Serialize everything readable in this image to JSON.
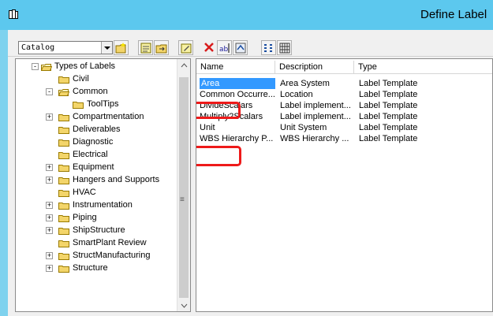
{
  "window": {
    "title": "Define Label"
  },
  "toolbar": {
    "combo_value": "Catalog",
    "buttons": [
      "new-folder-icon",
      "properties-icon",
      "move-icon",
      "edit-icon",
      "delete-icon",
      "rename-icon",
      "organize-icon",
      "list-view-icon",
      "details-view-icon"
    ]
  },
  "tree": {
    "root": "Types of Labels",
    "items": [
      {
        "label": "Civil"
      },
      {
        "label": "Common"
      },
      {
        "label": "ToolTips"
      },
      {
        "label": "Compartmentation"
      },
      {
        "label": "Deliverables"
      },
      {
        "label": "Diagnostic"
      },
      {
        "label": "Electrical"
      },
      {
        "label": "Equipment"
      },
      {
        "label": "Hangers and Supports"
      },
      {
        "label": "HVAC"
      },
      {
        "label": "Instrumentation"
      },
      {
        "label": "Piping"
      },
      {
        "label": "ShipStructure"
      },
      {
        "label": "SmartPlant Review"
      },
      {
        "label": "StructManufacturing"
      },
      {
        "label": "Structure"
      }
    ]
  },
  "list": {
    "columns": [
      "Name",
      "Description",
      "Type"
    ],
    "rows": [
      {
        "name": "Area",
        "description": "Area System",
        "type": "Label Template"
      },
      {
        "name": "Common Occurre...",
        "description": "Location",
        "type": "Label Template"
      },
      {
        "name": "DivideScalars",
        "description": "Label implement...",
        "type": "Label Template"
      },
      {
        "name": "Multiply2Scalars",
        "description": "Label implement...",
        "type": "Label Template"
      },
      {
        "name": "Unit",
        "description": "Unit System",
        "type": "Label Template"
      },
      {
        "name": "WBS Hierarchy P...",
        "description": "WBS Hierarchy ...",
        "type": "Label Template"
      }
    ]
  },
  "colors": {
    "title_bar": "#5cc8ee",
    "selection": "#3399ff",
    "highlight_box": "#ee1a1a"
  }
}
